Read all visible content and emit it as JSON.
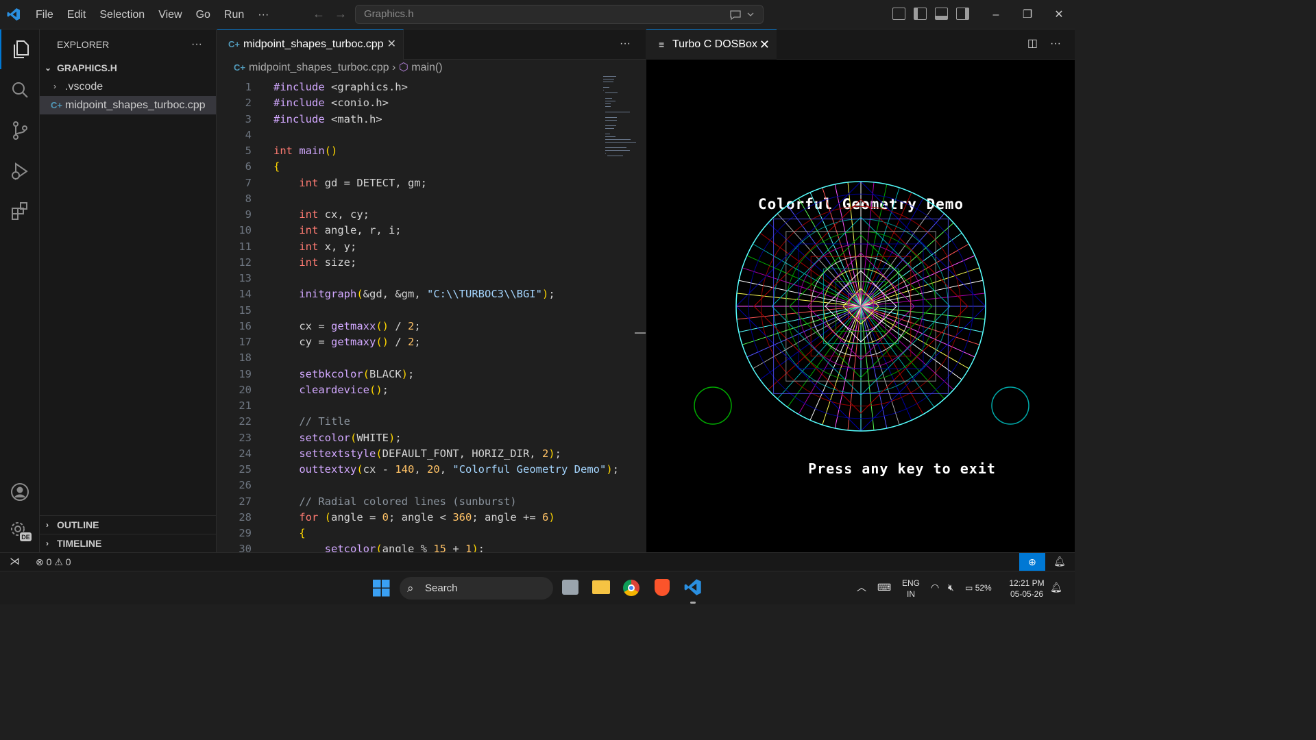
{
  "menu": [
    "File",
    "Edit",
    "Selection",
    "View",
    "Go",
    "Run",
    "···"
  ],
  "command_center": "Graphics.h",
  "explorer": {
    "title": "EXPLORER",
    "root": "GRAPHICS.H",
    "items": [
      ".vscode",
      "midpoint_shapes_turboc.cpp"
    ],
    "outline": "OUTLINE",
    "timeline": "TIMELINE",
    "account_badge": "DE"
  },
  "editor": {
    "tab_label": "midpoint_shapes_turboc.cpp",
    "breadcrumb_file": "midpoint_shapes_turboc.cpp",
    "breadcrumb_symbol": "main()",
    "more": "···",
    "lines": [
      "#include <graphics.h>",
      "#include <conio.h>",
      "#include <math.h>",
      "",
      "int main()",
      "{",
      "    int gd = DETECT, gm;",
      "",
      "    int cx, cy;",
      "    int angle, r, i;",
      "    int x, y;",
      "    int size;",
      "",
      "    initgraph(&gd, &gm, \"C:\\\\TURBOC3\\\\BGI\");",
      "",
      "    cx = getmaxx() / 2;",
      "    cy = getmaxy() / 2;",
      "",
      "    setbkcolor(BLACK);",
      "    cleardevice();",
      "",
      "    // Title",
      "    setcolor(WHITE);",
      "    settextstyle(DEFAULT_FONT, HORIZ_DIR, 2);",
      "    outtextxy(cx - 140, 20, \"Colorful Geometry Demo\");",
      "",
      "    // Radial colored lines (sunburst)",
      "    for (angle = 0; angle < 360; angle += 6)",
      "    {",
      "        setcolor(angle % 15 + 1);"
    ]
  },
  "dosbox": {
    "tab_label": "Turbo C DOSBox",
    "title_text": "Colorful Geometry Demo",
    "exit_text": "Press any key to exit",
    "palette": [
      "#5555ff",
      "#55ff55",
      "#55ffff",
      "#ff5555",
      "#ff55ff",
      "#ffff55",
      "#ffffff",
      "#aa00aa",
      "#00aa00",
      "#00aaaa",
      "#aa0000",
      "#0000aa",
      "#aaaaaa"
    ]
  },
  "status": {
    "errors": "0",
    "warnings": "0"
  },
  "taskbar": {
    "search": "Search",
    "lang_top": "ENG",
    "lang_bottom": "IN",
    "battery": "52%",
    "time": "12:21 PM",
    "date": "05-05-26"
  }
}
